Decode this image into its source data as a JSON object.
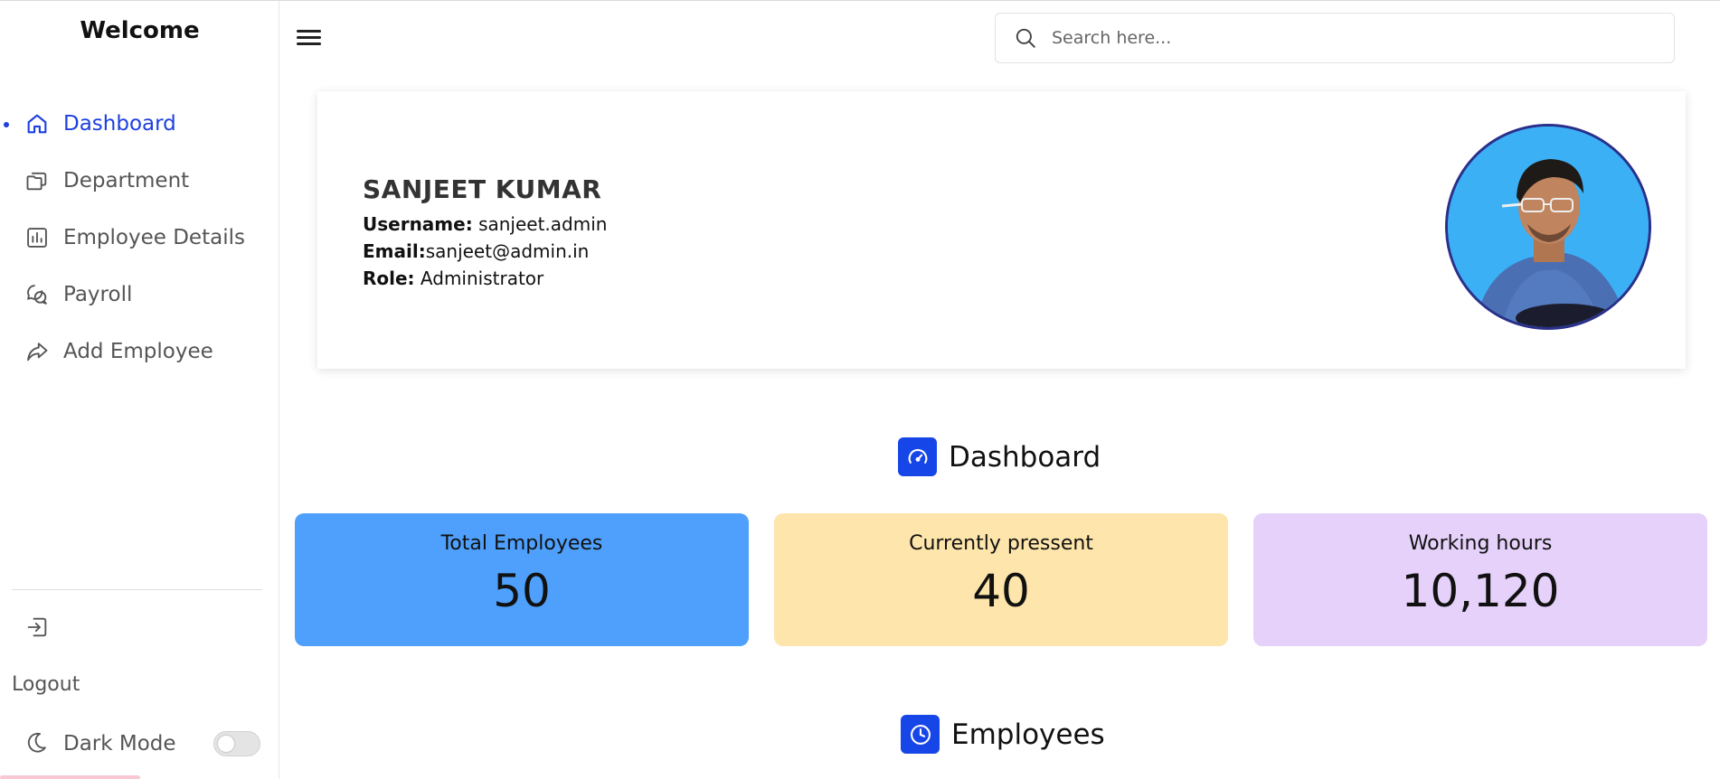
{
  "sidebar": {
    "welcome": "Welcome",
    "items": [
      {
        "label": "Dashboard",
        "icon": "home-icon",
        "active": true
      },
      {
        "label": "Department",
        "icon": "folders-icon"
      },
      {
        "label": "Employee Details",
        "icon": "bar-chart-icon"
      },
      {
        "label": "Payroll",
        "icon": "chat-bubbles-icon"
      },
      {
        "label": "Add Employee",
        "icon": "share-arrow-icon"
      }
    ],
    "logout_label": "Logout",
    "dark_mode_label": "Dark Mode",
    "dark_mode_enabled": false
  },
  "header": {
    "search_placeholder": "Search here..."
  },
  "profile": {
    "name": "SANJEET KUMAR",
    "username_label": "Username:",
    "username": " sanjeet.admin",
    "email_label": "Email:",
    "email": "sanjeet@admin.in",
    "role_label": "Role:",
    "role": " Administrator"
  },
  "dashboard": {
    "title": "Dashboard",
    "stats": [
      {
        "label": "Total Employees",
        "value": "50",
        "color": "#4fa0fc"
      },
      {
        "label": "Currently pressent",
        "value": "40",
        "color": "#fde5ab"
      },
      {
        "label": "Working hours",
        "value": "10,120",
        "color": "#e6d1fa"
      }
    ]
  },
  "employees": {
    "title": "Employees"
  },
  "colors": {
    "accent": "#1d3fe0",
    "badge": "#1746e8"
  }
}
